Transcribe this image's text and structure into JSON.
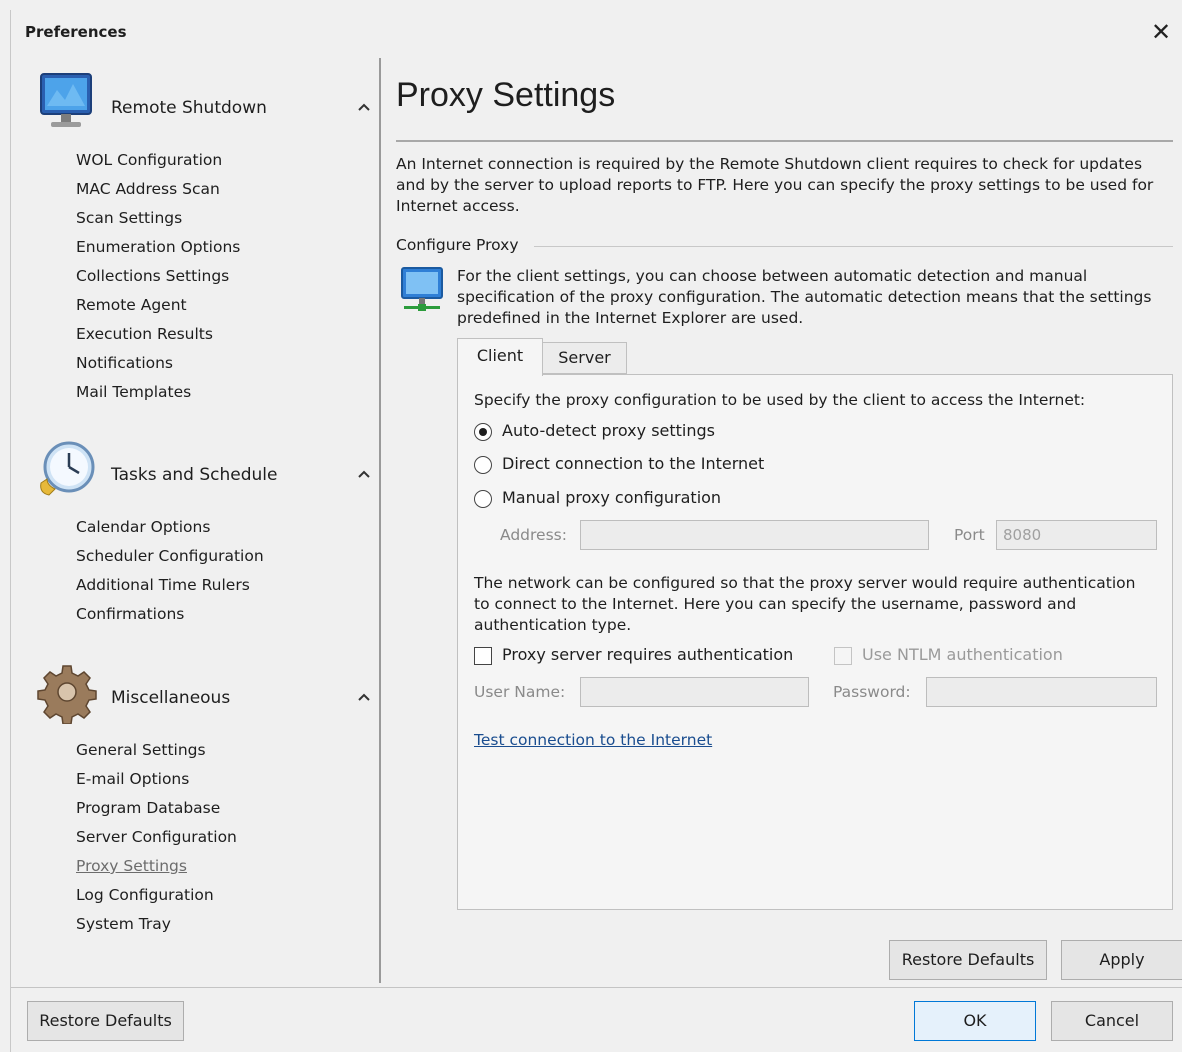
{
  "window": {
    "title": "Preferences",
    "close_glyph": "✕"
  },
  "sidebar": {
    "groups": [
      {
        "title": "Remote Shutdown",
        "icon": "monitor-icon",
        "items": [
          "WOL Configuration",
          "MAC Address Scan",
          "Scan Settings",
          "Enumeration Options",
          "Collections Settings",
          "Remote Agent",
          "Execution Results",
          "Notifications",
          "Mail Templates"
        ]
      },
      {
        "title": "Tasks and Schedule",
        "icon": "clock-icon",
        "items": [
          "Calendar Options",
          "Scheduler Configuration",
          "Additional Time Rulers",
          "Confirmations"
        ]
      },
      {
        "title": "Miscellaneous",
        "icon": "gear-icon",
        "items": [
          "General Settings",
          "E-mail Options",
          "Program Database",
          "Server Configuration",
          "Proxy Settings",
          "Log Configuration",
          "System Tray"
        ]
      }
    ],
    "active_item": "Proxy Settings"
  },
  "main": {
    "title": "Proxy Settings",
    "description": "An Internet connection is required by the Remote Shutdown client requires to check for updates and by the server to upload reports to FTP. Here you can specify the proxy settings to be used for Internet access.",
    "section_title": "Configure Proxy",
    "section_info": "For the client settings, you can choose between automatic detection and manual specification of the proxy configuration. The automatic detection means that the settings predefined in the Internet Explorer are used.",
    "tabs": [
      "Client",
      "Server"
    ],
    "active_tab": "Client",
    "panel": {
      "intro": "Specify the proxy configuration to be used by the client to access the Internet:",
      "radios": [
        "Auto-detect proxy settings",
        "Direct connection to the Internet",
        "Manual proxy configuration"
      ],
      "selected_radio": "Auto-detect proxy settings",
      "address_label": "Address:",
      "address_value": "",
      "port_label": "Port",
      "port_value": "8080",
      "auth_text": "The network can be configured so that the proxy server would require authentication to connect to the Internet. Here you can specify the username, password and authentication type.",
      "auth_checkbox": "Proxy server requires authentication",
      "ntlm_checkbox": "Use NTLM authentication",
      "username_label": "User Name:",
      "username_value": "",
      "password_label": "Password:",
      "password_value": "",
      "test_link": "Test connection to the Internet"
    },
    "restore_defaults": "Restore Defaults",
    "apply": "Apply"
  },
  "footer": {
    "restore_defaults": "Restore Defaults",
    "ok": "OK",
    "cancel": "Cancel"
  },
  "colors": {
    "accent": "#0078d7",
    "link": "#1a4d8f",
    "background": "#f0f0f0"
  }
}
